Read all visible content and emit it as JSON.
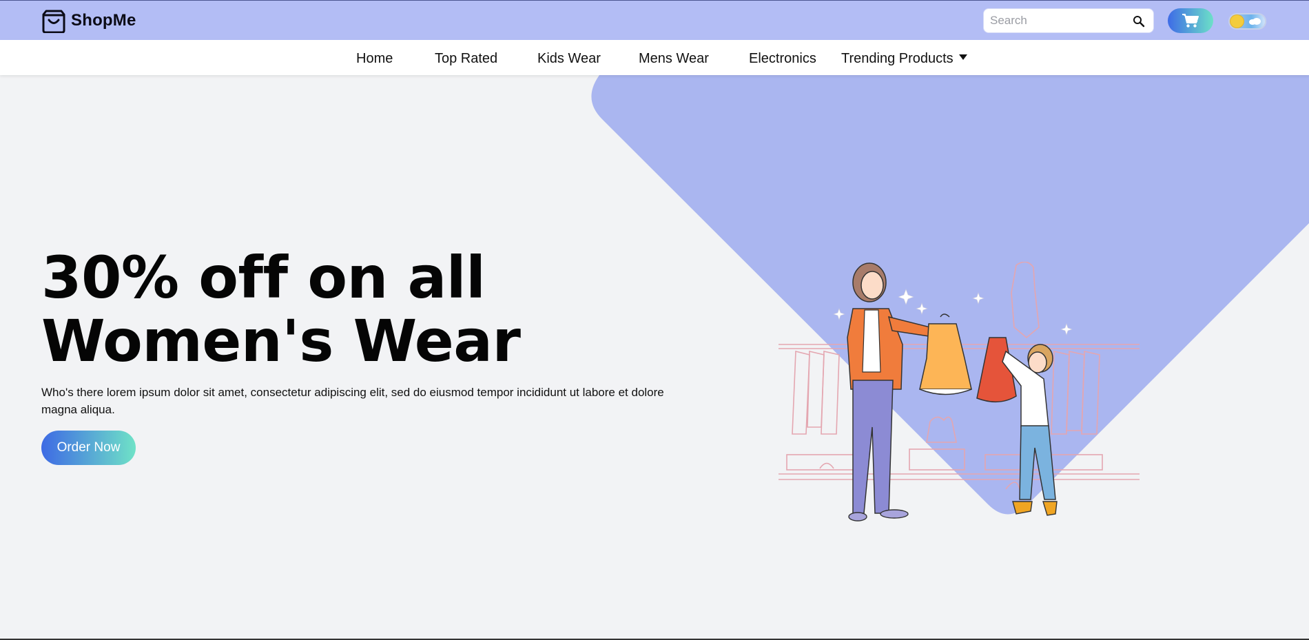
{
  "brand": {
    "name": "ShopMe",
    "icon": "shopping-bag-icon"
  },
  "search": {
    "placeholder": "Search",
    "value": "",
    "icon": "search-icon"
  },
  "cart": {
    "icon": "cart-icon"
  },
  "theme_toggle": {
    "state": "light",
    "icon": "sun-icon"
  },
  "nav": {
    "items": [
      {
        "label": "Home"
      },
      {
        "label": "Top Rated"
      },
      {
        "label": "Kids Wear"
      },
      {
        "label": "Mens Wear"
      },
      {
        "label": "Electronics"
      },
      {
        "label": "Trending Products",
        "has_dropdown": true
      }
    ]
  },
  "hero": {
    "headline_line1": "30% off on all",
    "headline_line2": "Women's Wear",
    "description": "Who's there lorem ipsum dolor sit amet, consectetur adipiscing elit, sed do eiusmod tempor incididunt ut labore et dolore magna aliqua.",
    "cta_label": "Order Now",
    "illustration": "shopping-illustration"
  },
  "colors": {
    "topbar": "#b3bdf5",
    "accent_shape": "#aab6f0",
    "gradient_start": "#3e6be6",
    "gradient_end": "#6ce0c8"
  }
}
